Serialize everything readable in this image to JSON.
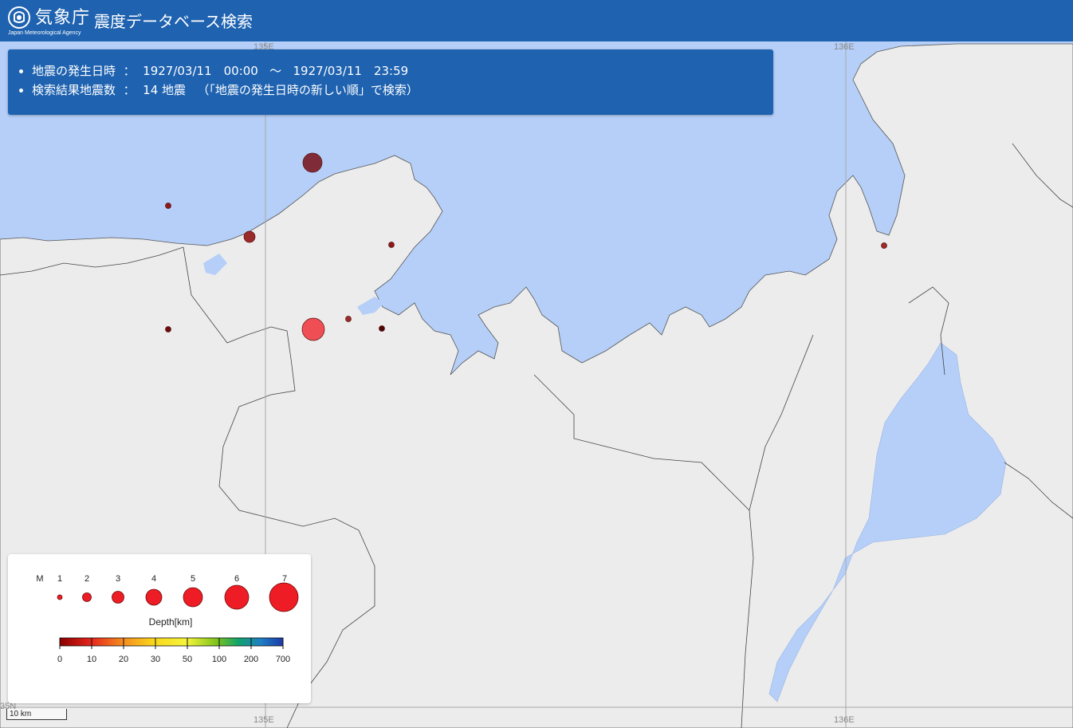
{
  "header": {
    "agency_name": "気象庁",
    "agency_name_en": "Japan Meteorological Agency",
    "app_title": "震度データベース検索"
  },
  "info": {
    "date_label": "地震の発生日時",
    "colon": "：",
    "date_from": "1927/03/11　00:00",
    "tilde": "～",
    "date_to": "1927/03/11　23:59",
    "count_label": "検索結果地震数",
    "count_value": "14 地震",
    "order_note": "（「地震の発生日時の新しい順」で検索）"
  },
  "grid_labels": {
    "lon_135_top": "135E",
    "lon_136_top": "136E",
    "lon_135_bottom": "135E",
    "lon_136_bottom": "136E",
    "lat_35": "35N"
  },
  "scale_bar": {
    "label": "10 km"
  },
  "legend": {
    "magnitude_label": "M",
    "magnitudes": [
      "1",
      "2",
      "3",
      "4",
      "5",
      "6",
      "7"
    ],
    "depth_title": "Depth[km]",
    "depth_ticks": [
      "0",
      "10",
      "20",
      "30",
      "50",
      "100",
      "200",
      "700"
    ],
    "depth_colors": [
      "#8b0000",
      "#e5261c",
      "#f58a1f",
      "#f9d71c",
      "#f5f53a",
      "#7fc41c",
      "#10a36b",
      "#1e7fc4",
      "#1c3aa8"
    ]
  },
  "colors": {
    "header_bg": "#1e62b0",
    "sea": "#b5cff8",
    "land": "#efefef",
    "quake_shallow": "#8b1a1a",
    "quake_red": "#e83a3a"
  }
}
